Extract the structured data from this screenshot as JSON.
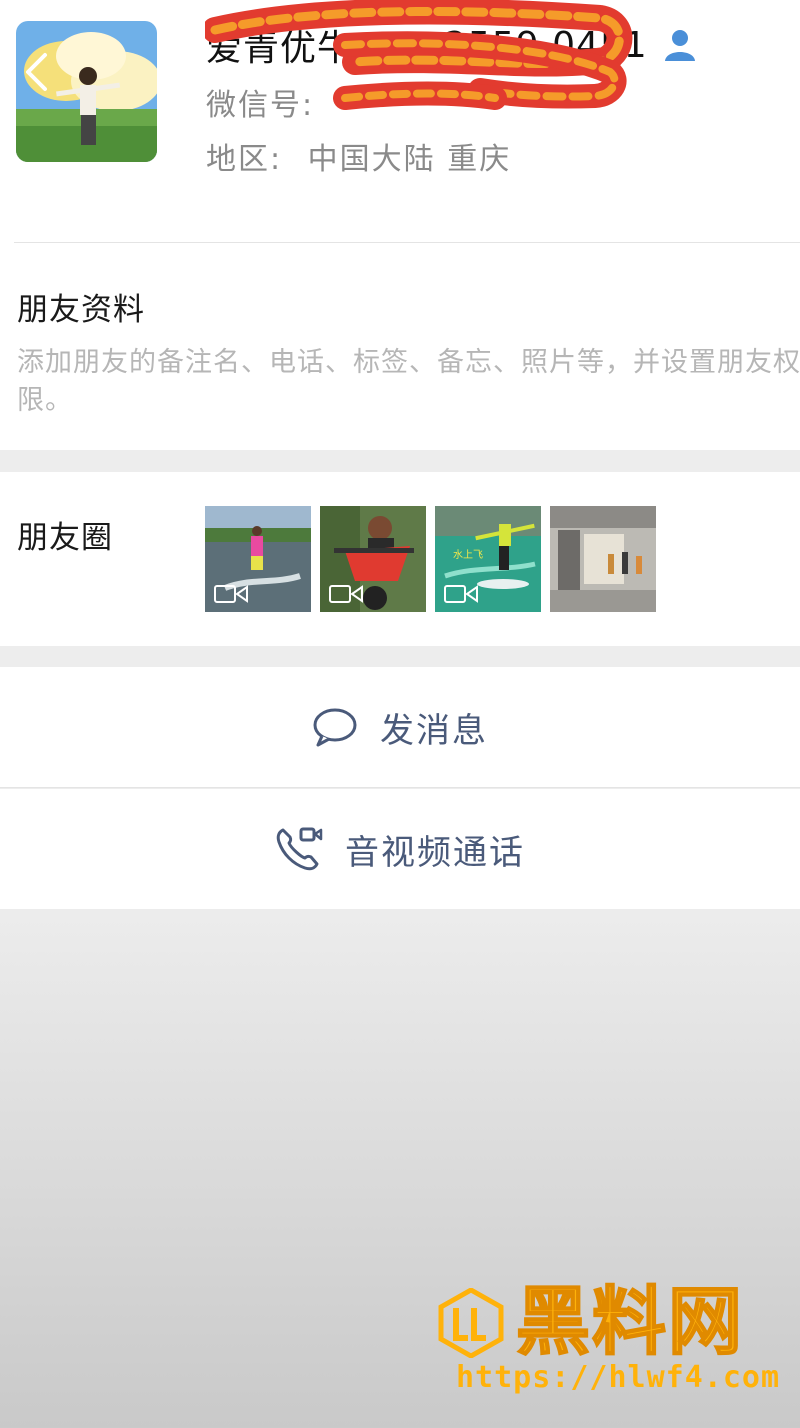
{
  "profile": {
    "nickname": "爱青优牛",
    "nickname_suffix": "2559 0451",
    "wechat_label": "微信号:",
    "region_label": "地区:",
    "region_value": "中国大陆  重庆"
  },
  "friend_info": {
    "title": "朋友资料",
    "description": "添加朋友的备注名、电话、标签、备忘、照片等，并设置朋友权限。"
  },
  "moments": {
    "title": "朋友圈",
    "thumbnails": [
      {
        "kind": "video",
        "icon": "video-icon",
        "scene": "water-ski"
      },
      {
        "kind": "video",
        "icon": "video-icon",
        "scene": "motorbike"
      },
      {
        "kind": "video",
        "icon": "video-icon",
        "scene": "hydrofoil",
        "caption": "水上飞"
      },
      {
        "kind": "photo",
        "scene": "hallway"
      }
    ]
  },
  "actions": {
    "send_message": "发消息",
    "av_call": "音视频通话"
  },
  "watermark": {
    "brand": "黑料网",
    "url": "https://hlwf4.com"
  },
  "colors": {
    "accent_text": "#4a5a7a",
    "gender_icon": "#4a8fd8",
    "watermark": "#ffb20a",
    "scribble_red": "#e23b2f",
    "scribble_orange": "#f59b2a"
  }
}
